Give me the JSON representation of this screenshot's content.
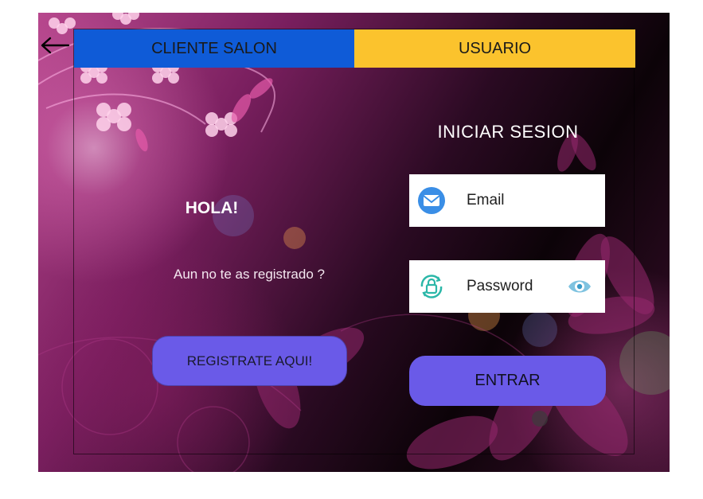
{
  "tabs": [
    {
      "label": "CLIENTE SALON",
      "color": "#0f5bd7"
    },
    {
      "label": "USUARIO",
      "color": "#fbc32d"
    }
  ],
  "left_panel": {
    "greeting": "HOLA!",
    "prompt": "Aun no te as registrado ?",
    "register_button": "REGISTRATE AQUI!"
  },
  "login": {
    "title": "INICIAR SESION",
    "email_label": "Email",
    "password_label": "Password",
    "submit_button": "ENTRAR"
  },
  "icons": {
    "back": "arrow-left-icon",
    "email": "envelope-icon",
    "password": "lock-icon",
    "toggle_password": "eye-icon"
  },
  "colors": {
    "button": "#6a5ae8",
    "background": "#2a0a22"
  }
}
